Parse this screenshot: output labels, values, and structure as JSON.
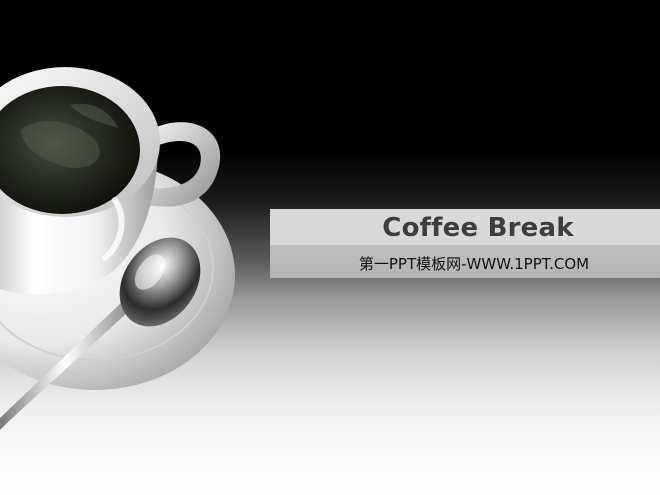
{
  "slide": {
    "title": "Coffee Break",
    "subtitle": "第一PPT模板网-WWW.1PPT.COM"
  },
  "image": {
    "subject": "coffee-cup-with-saucer-and-spoon"
  }
}
